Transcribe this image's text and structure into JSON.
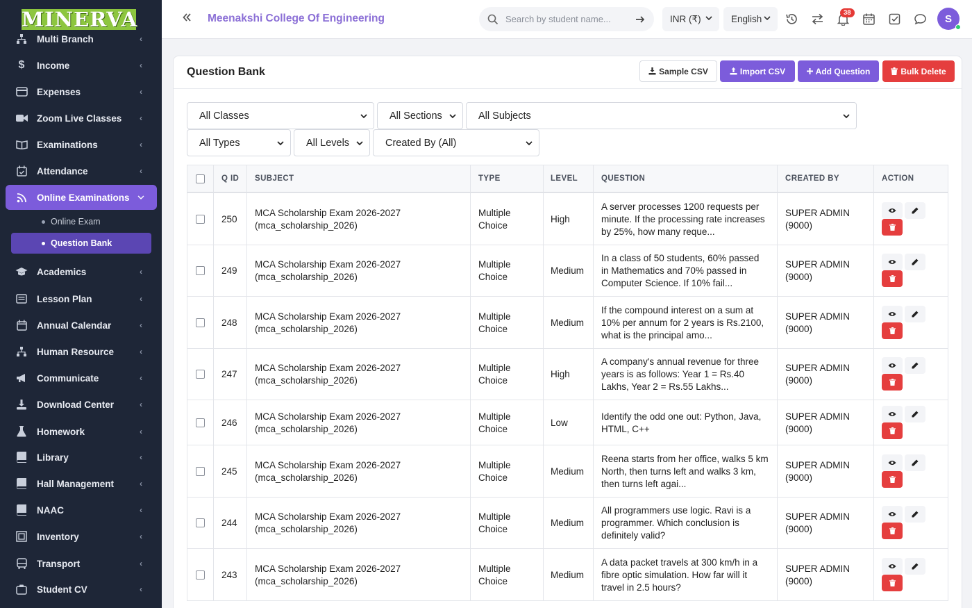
{
  "brand": {
    "logo_text": "MINERVA"
  },
  "sidebar": {
    "items": [
      {
        "label": "Multi Branch",
        "icon": "sitemap-icon"
      },
      {
        "label": "Income",
        "icon": "dollar-icon"
      },
      {
        "label": "Expenses",
        "icon": "credit-card-icon"
      },
      {
        "label": "Zoom Live Classes",
        "icon": "video-icon"
      },
      {
        "label": "Examinations",
        "icon": "book-open-icon"
      },
      {
        "label": "Attendance",
        "icon": "calendar-check-icon"
      },
      {
        "label": "Online Examinations",
        "icon": "rss-icon"
      },
      {
        "label": "Academics",
        "icon": "graduation-cap-icon"
      },
      {
        "label": "Lesson Plan",
        "icon": "list-icon"
      },
      {
        "label": "Annual Calendar",
        "icon": "calendar-icon"
      },
      {
        "label": "Human Resource",
        "icon": "hierarchy-icon"
      },
      {
        "label": "Communicate",
        "icon": "megaphone-icon"
      },
      {
        "label": "Download Center",
        "icon": "download-icon"
      },
      {
        "label": "Homework",
        "icon": "flask-icon"
      },
      {
        "label": "Library",
        "icon": "book-icon"
      },
      {
        "label": "Hall Management",
        "icon": "book-icon"
      },
      {
        "label": "NAAC",
        "icon": "book-icon"
      },
      {
        "label": "Inventory",
        "icon": "box-icon"
      },
      {
        "label": "Transport",
        "icon": "bus-icon"
      },
      {
        "label": "Student CV",
        "icon": "id-card-icon"
      }
    ],
    "sub_items": [
      {
        "label": "Online Exam"
      },
      {
        "label": "Question Bank"
      }
    ]
  },
  "topbar": {
    "college_name": "Meenakshi College Of Engineering",
    "search_placeholder": "Search by student name...",
    "currency": "INR (₹)",
    "language": "English",
    "notification_count": "38",
    "avatar_initial": "S"
  },
  "page": {
    "title": "Question Bank",
    "buttons": {
      "sample_csv": "Sample CSV",
      "import_csv": "Import CSV",
      "add_question": "Add Question",
      "bulk_delete": "Bulk Delete"
    },
    "filters": {
      "classes": "All Classes",
      "sections": "All Sections",
      "subjects": "All Subjects",
      "types": "All Types",
      "levels": "All Levels",
      "created_by": "Created By (All)"
    }
  },
  "table": {
    "headers": [
      "Q ID",
      "SUBJECT",
      "TYPE",
      "LEVEL",
      "QUESTION",
      "CREATED BY",
      "ACTION"
    ],
    "rows": [
      {
        "id": "250",
        "subject1": "MCA Scholarship Exam 2026-2027",
        "subject2": "(mca_scholarship_2026)",
        "type1": "Multiple",
        "type2": "Choice",
        "level": "High",
        "q1": "A server processes 1200 requests per",
        "q2": "minute. If the processing rate increases",
        "q3": "by 25%, how many reque...",
        "by1": "SUPER ADMIN",
        "by2": "(9000)"
      },
      {
        "id": "249",
        "subject1": "MCA Scholarship Exam 2026-2027",
        "subject2": "(mca_scholarship_2026)",
        "type1": "Multiple",
        "type2": "Choice",
        "level": "Medium",
        "q1": "In a class of 50 students, 60% passed",
        "q2": "in Mathematics and 70% passed in",
        "q3": "Computer Science. If 10% fail...",
        "by1": "SUPER ADMIN",
        "by2": "(9000)"
      },
      {
        "id": "248",
        "subject1": "MCA Scholarship Exam 2026-2027",
        "subject2": "(mca_scholarship_2026)",
        "type1": "Multiple",
        "type2": "Choice",
        "level": "Medium",
        "q1": "If the compound interest on a sum at",
        "q2": "10% per annum for 2 years is Rs.2100,",
        "q3": "what is the principal amo...",
        "by1": "SUPER ADMIN",
        "by2": "(9000)"
      },
      {
        "id": "247",
        "subject1": "MCA Scholarship Exam 2026-2027",
        "subject2": "(mca_scholarship_2026)",
        "type1": "Multiple",
        "type2": "Choice",
        "level": "High",
        "q1": "A company's annual revenue for three",
        "q2": "years is as follows: Year 1 = Rs.40",
        "q3": "Lakhs, Year 2 = Rs.55 Lakhs...",
        "by1": "SUPER ADMIN",
        "by2": "(9000)"
      },
      {
        "id": "246",
        "subject1": "MCA Scholarship Exam 2026-2027",
        "subject2": "(mca_scholarship_2026)",
        "type1": "Multiple",
        "type2": "Choice",
        "level": "Low",
        "q1": "Identify the odd one out: Python, Java,",
        "q2": "HTML, C++",
        "q3": "",
        "by1": "SUPER ADMIN",
        "by2": "(9000)"
      },
      {
        "id": "245",
        "subject1": "MCA Scholarship Exam 2026-2027",
        "subject2": "(mca_scholarship_2026)",
        "type1": "Multiple",
        "type2": "Choice",
        "level": "Medium",
        "q1": "Reena starts from her office, walks 5 km",
        "q2": "North, then turns left and walks 3 km,",
        "q3": "then turns left agai...",
        "by1": "SUPER ADMIN",
        "by2": "(9000)"
      },
      {
        "id": "244",
        "subject1": "MCA Scholarship Exam 2026-2027",
        "subject2": "(mca_scholarship_2026)",
        "type1": "Multiple",
        "type2": "Choice",
        "level": "Medium",
        "q1": "All programmers use logic. Ravi is a",
        "q2": "programmer. Which conclusion is",
        "q3": "definitely valid?",
        "by1": "SUPER ADMIN",
        "by2": "(9000)"
      },
      {
        "id": "243",
        "subject1": "MCA Scholarship Exam 2026-2027",
        "subject2": "(mca_scholarship_2026)",
        "type1": "Multiple",
        "type2": "Choice",
        "level": "Medium",
        "q1": "A data packet travels at 300 km/h in a",
        "q2": "fibre optic simulation. How far will it",
        "q3": "travel in 2.5 hours?",
        "by1": "SUPER ADMIN",
        "by2": "(9000)"
      }
    ]
  },
  "colors": {
    "accent": "#7c5cdb",
    "danger": "#e53e3e",
    "sidebar_bg": "#1e2637",
    "logo_bg": "#8dc63f"
  }
}
